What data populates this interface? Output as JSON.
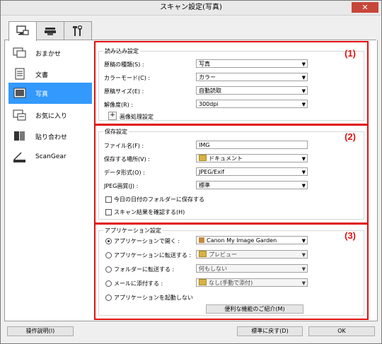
{
  "window": {
    "title": "スキャン設定(写真)",
    "close_glyph": "✕"
  },
  "tabs": [
    {
      "name": "scan-from-computer",
      "icon": "computer-scanner-icon",
      "active": true
    },
    {
      "name": "scan-from-operation-panel",
      "icon": "scanner-icon",
      "active": false
    },
    {
      "name": "general-settings",
      "icon": "tools-icon",
      "active": false
    }
  ],
  "sidebar": {
    "items": [
      {
        "label": "おまかせ",
        "icon": "auto-scan-icon",
        "selected": false
      },
      {
        "label": "文書",
        "icon": "document-icon",
        "selected": false
      },
      {
        "label": "写真",
        "icon": "photo-icon",
        "selected": true
      },
      {
        "label": "お気に入り",
        "icon": "favorite-icon",
        "selected": false
      },
      {
        "label": "貼り合わせ",
        "icon": "stitch-icon",
        "selected": false
      },
      {
        "label": "ScanGear",
        "icon": "scangear-icon",
        "selected": false
      }
    ]
  },
  "scan_options": {
    "group_title": "読み込み設定",
    "number": "(1)",
    "rows": [
      {
        "label": "原稿の種類(S) :",
        "value": "写真"
      },
      {
        "label": "カラーモード(C) :",
        "value": "カラー"
      },
      {
        "label": "原稿サイズ(E) :",
        "value": "自動読取"
      },
      {
        "label": "解像度(R) :",
        "value": "300dpi"
      }
    ],
    "image_processing": {
      "expander": "+",
      "label": "画像処理設定"
    }
  },
  "save_settings": {
    "group_title": "保存設定",
    "number": "(2)",
    "file_name": {
      "label": "ファイル名(F) :",
      "value": "IMG"
    },
    "save_in": {
      "label": "保存する場所(V) :",
      "value": "ドキュメント"
    },
    "data_format": {
      "label": "データ形式(O) :",
      "value": "JPEG/Exif"
    },
    "jpeg_quality": {
      "label": "JPEG画質(J) :",
      "value": "標準"
    },
    "checkboxes": [
      {
        "label": "今日の日付のフォルダーに保存する",
        "checked": false
      },
      {
        "label": "スキャン結果を確認する(H)",
        "checked": false
      }
    ]
  },
  "app_settings": {
    "group_title": "アプリケーション設定",
    "number": "(3)",
    "options": [
      {
        "label": "アプリケーションで開く :",
        "value": "Canon My Image Garden",
        "selected": true,
        "disabled": false,
        "icon": "app-icon"
      },
      {
        "label": "アプリケーションに転送する :",
        "value": "プレビュー",
        "selected": false,
        "disabled": true,
        "icon": "folder-icon"
      },
      {
        "label": "フォルダーに転送する :",
        "value": "何もしない",
        "selected": false,
        "disabled": true,
        "icon": ""
      },
      {
        "label": "メールに添付する :",
        "value": "なし(手動で添付)",
        "selected": false,
        "disabled": true,
        "icon": "folder-icon"
      },
      {
        "label": "アプリケーションを起動しない",
        "value": "",
        "selected": false,
        "disabled": false,
        "icon": ""
      }
    ],
    "more_functions_button": "便利な機能のご紹介(M)"
  },
  "footer": {
    "instructions": "操作説明(I)",
    "defaults": "標準に戻す(D)",
    "ok": "OK"
  },
  "colors": {
    "accent_red": "#e01010",
    "selection_blue": "#3399ff"
  }
}
